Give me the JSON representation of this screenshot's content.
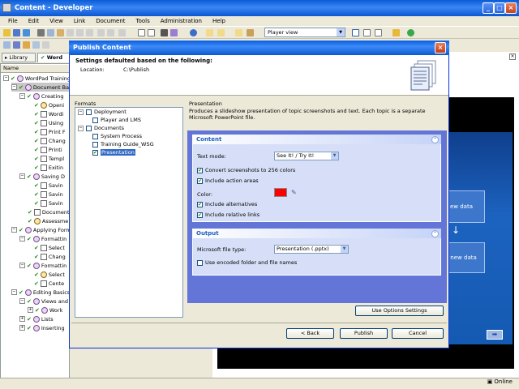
{
  "app": {
    "title": "Content - Developer"
  },
  "menu": [
    "File",
    "Edit",
    "View",
    "Link",
    "Document",
    "Tools",
    "Administration",
    "Help"
  ],
  "toolbar": {
    "player_view": "Player view"
  },
  "outline": {
    "tabs": [
      "Library",
      "Word"
    ],
    "column_name": "Name",
    "rows": [
      "WordPad Training",
      "Document Ba",
      "Creating",
      "Openi",
      "Wordi",
      "Using",
      "Print F",
      "Chang",
      "Printi",
      "Templ",
      "Exitin",
      "Saving D",
      "Savin",
      "Savin",
      "Savin",
      "Document",
      "Assessme",
      "Applying Form",
      "Formattin",
      "Select",
      "Chang",
      "Formattin",
      "Select",
      "Cente",
      "Editing Basics",
      "Views and",
      "Work",
      "Lists",
      "Inserting"
    ]
  },
  "preview": {
    "box1": "ew data",
    "box2": "r new data"
  },
  "status": {
    "online": "Online"
  },
  "dialog": {
    "title": "Publish Content",
    "heading": "Settings defaulted based on the following:",
    "location_label": "Location:",
    "location_value": "C:\\Publish",
    "formats_label": "Formats",
    "formats": {
      "deployment": "Deployment",
      "player_lms": "Player and LMS",
      "documents": "Documents",
      "system_process": "System Process",
      "training_guide": "Training Guide_WSG",
      "presentation": "Presentation"
    },
    "presentation_label": "Presentation",
    "presentation_desc": "Produces a slideshow presentation of topic screenshots and text.  Each topic is a separate Microsoft PowerPoint file.",
    "content_group": {
      "title": "Content",
      "text_mode_label": "Text mode:",
      "text_mode_value": "See It! / Try It!",
      "convert_256": "Convert screenshots to 256 colors",
      "include_action_areas": "Include action areas",
      "color_label": "Color:",
      "include_alternatives": "Include alternatives",
      "include_relative_links": "Include relative links"
    },
    "output_group": {
      "title": "Output",
      "file_type_label": "Microsoft file type:",
      "file_type_value": "Presentation (.pptx)",
      "encoded_names": "Use encoded folder and file names"
    },
    "use_options_button": "Use Options Settings",
    "back_button": "< Back",
    "publish_button": "Publish",
    "cancel_button": "Cancel"
  },
  "colors": {
    "accent_color_swatch": "#ff0000",
    "title_blue": "#0a5bd6"
  }
}
